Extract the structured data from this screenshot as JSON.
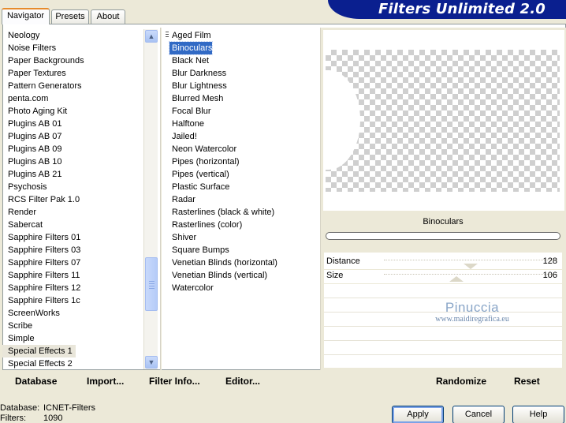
{
  "window": {
    "title": "Filters Unlimited 2.0",
    "tabs": [
      "Navigator",
      "Presets",
      "About"
    ]
  },
  "categories": {
    "items": [
      "Neology",
      "Noise Filters",
      "Paper Backgrounds",
      "Paper Textures",
      "Pattern Generators",
      "penta.com",
      "Photo Aging Kit",
      "Plugins AB 01",
      "Plugins AB 07",
      "Plugins AB 09",
      "Plugins AB 10",
      "Plugins AB 21",
      "Psychosis",
      "RCS Filter Pak 1.0",
      "Render",
      "Sabercat",
      "Sapphire Filters 01",
      "Sapphire Filters 03",
      "Sapphire Filters 07",
      "Sapphire Filters 11",
      "Sapphire Filters 12",
      "Sapphire Filters 1c",
      "ScreenWorks",
      "Scribe",
      "Simple",
      "Special Effects 1",
      "Special Effects 2"
    ],
    "selected": "Special Effects 1"
  },
  "filters": {
    "items": [
      "Aged Film",
      "Binoculars",
      "Black Net",
      "Blur Darkness",
      "Blur Lightness",
      "Blurred Mesh",
      "Focal Blur",
      "Halftone",
      "Jailed!",
      "Neon Watercolor",
      "Pipes (horizontal)",
      "Pipes (vertical)",
      "Plastic Surface",
      "Radar",
      "Rasterlines (black & white)",
      "Rasterlines (color)",
      "Shiver",
      "Square Bumps",
      "Venetian Blinds (horizontal)",
      "Venetian Blinds (vertical)",
      "Watercolor"
    ],
    "selected": "Binoculars"
  },
  "preview": {
    "filter_name": "Binoculars"
  },
  "parameters": [
    {
      "label": "Distance",
      "value": "128",
      "level": 0.5
    },
    {
      "label": "Size",
      "value": "106",
      "level": 0.42
    }
  ],
  "watermark": {
    "name": "Pinuccia",
    "url": "www.maidiregrafica.eu"
  },
  "actions": {
    "database": "Database",
    "import": "Import...",
    "filter_info": "Filter Info...",
    "editor": "Editor...",
    "randomize": "Randomize",
    "reset": "Reset"
  },
  "status": {
    "database_label": "Database:",
    "database_value": "ICNET-Filters",
    "filters_label": "Filters:",
    "filters_value": "1090"
  },
  "dialog": {
    "apply": "Apply",
    "cancel": "Cancel",
    "help": "Help"
  },
  "colors": {
    "title_bar": "#0a1f8f",
    "selection": "#316ac5",
    "category_highlight": "#e9e6da"
  }
}
